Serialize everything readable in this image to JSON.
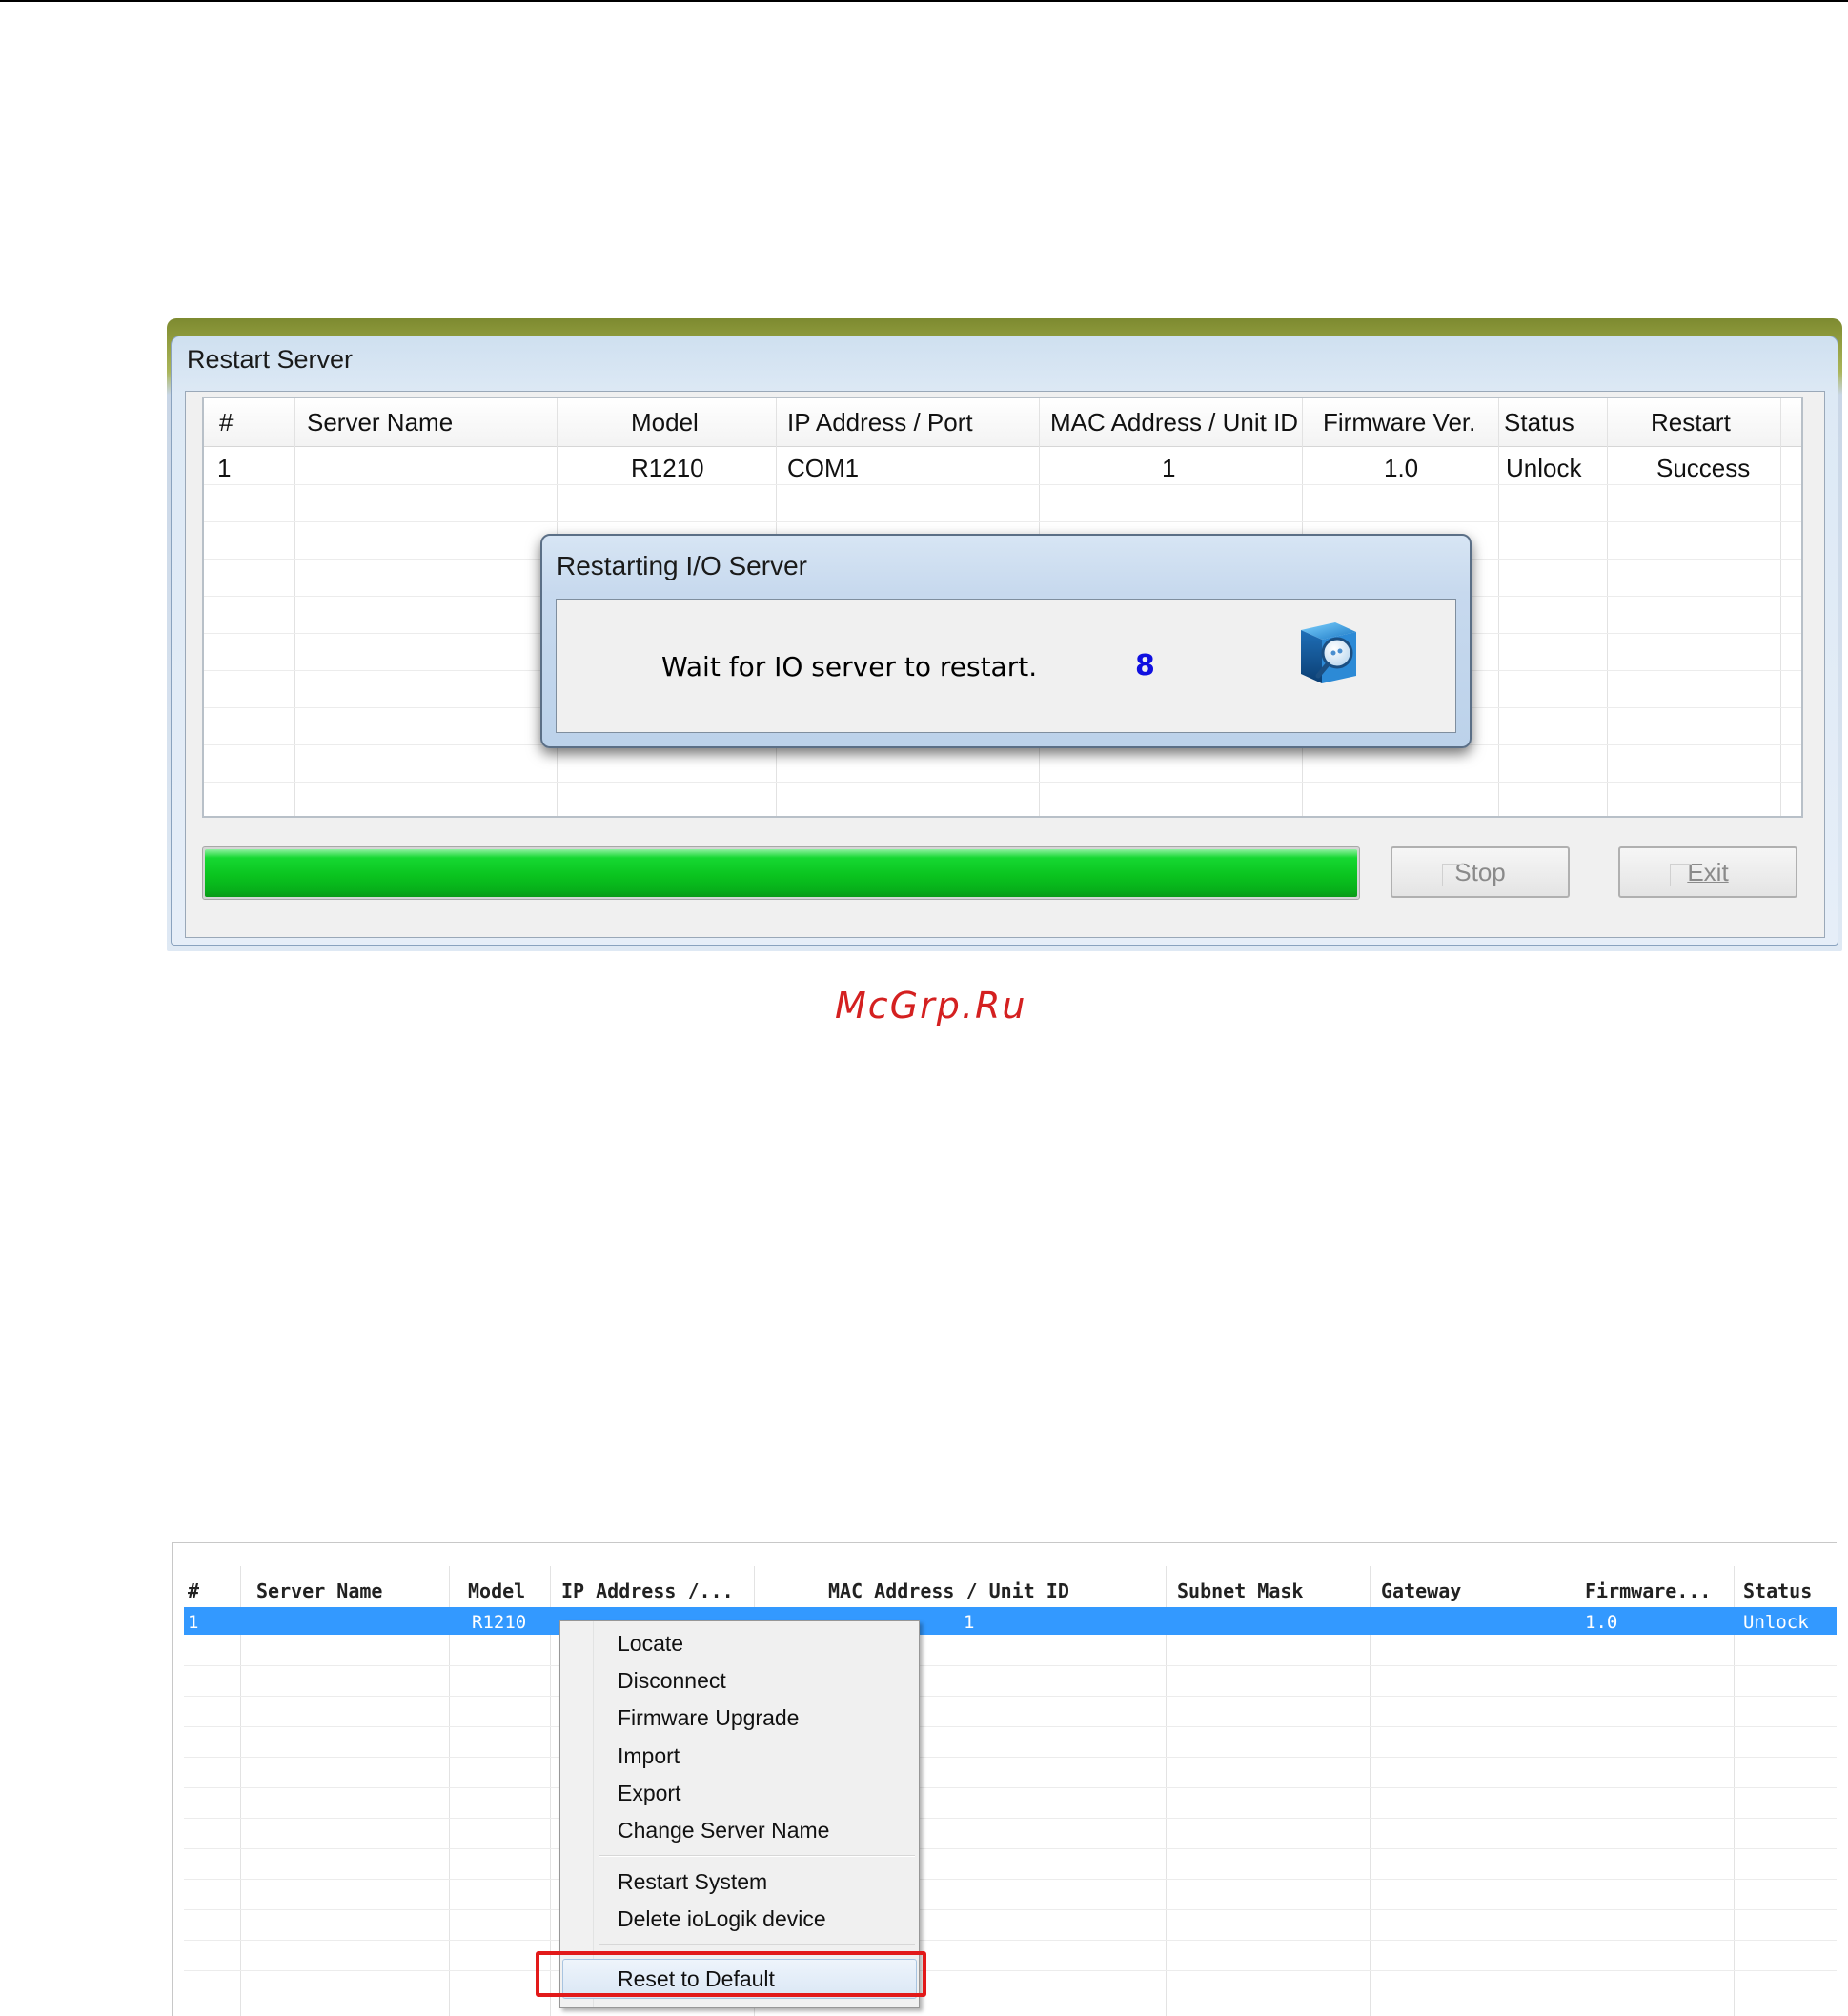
{
  "restart_window": {
    "title": "Restart Server",
    "columns": [
      "#",
      "Server Name",
      "Model",
      "IP Address / Port",
      "MAC Address / Unit ID",
      "Firmware Ver.",
      "Status",
      "Restart"
    ],
    "row": {
      "num": "1",
      "server_name": "",
      "model": "R1210",
      "ip": "COM1",
      "mac": "1",
      "firmware": "1.0",
      "status": "Unlock",
      "restart": "Success"
    },
    "progress_fraction": 1.0,
    "stop_label": "Stop",
    "exit_label": "Exit"
  },
  "dialog": {
    "title": "Restarting I/O Server",
    "message": "Wait for IO server to restart.",
    "countdown": "8"
  },
  "watermark": "McGrp.Ru",
  "device_list": {
    "columns": [
      "#",
      "Server Name",
      "Model",
      "IP Address /...",
      "MAC Address / Unit ID",
      "Subnet Mask",
      "Gateway",
      "Firmware...",
      "Status"
    ],
    "row": {
      "num": "1",
      "server_name": "",
      "model": "R1210",
      "ip": "",
      "mac": "1",
      "subnet": "",
      "gateway": "",
      "firmware": "1.0",
      "status": "Unlock"
    }
  },
  "context_menu": {
    "group1": [
      "Locate",
      "Disconnect",
      "Firmware Upgrade",
      "Import",
      "Export",
      "Change Server Name"
    ],
    "group2": [
      "Restart System",
      "Delete ioLogik device"
    ],
    "group3": [
      "Reset to Default"
    ]
  },
  "colors": {
    "highlight": "#e21a1a",
    "selection": "#3399ff",
    "progress": "#0ac41f",
    "countdown": "#1010e0"
  }
}
